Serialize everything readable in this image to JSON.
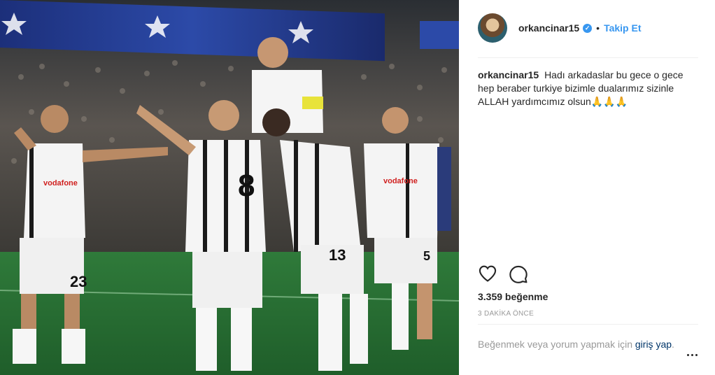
{
  "post": {
    "username": "orkancinar15",
    "follow_label": "Takip Et",
    "separator": "•",
    "caption_text": "Hadı arkadaslar bu gece o gece hep beraber turkiye bizimle dualarımız sizinle ALLAH yardımcımız olsun",
    "caption_emoji": "🙏🙏🙏",
    "likes": "3.359 beğenme",
    "time": "3 DAKİKA ÖNCE",
    "login_prefix": "Beğenmek veya yorum yapmak için",
    "login_link": "giriş yap",
    "login_suffix": "."
  },
  "photo": {
    "jersey_numbers": [
      "23",
      "8",
      "13",
      "5"
    ],
    "sponsor": "vodafone"
  },
  "icons": {
    "verified": "verified-badge-icon",
    "like": "heart-icon",
    "comment": "comment-icon",
    "more": "more-options-icon"
  },
  "colors": {
    "link_blue": "#3897f0",
    "dark_link": "#003569",
    "text": "#262626",
    "muted": "#999999",
    "divider": "#efefef"
  }
}
